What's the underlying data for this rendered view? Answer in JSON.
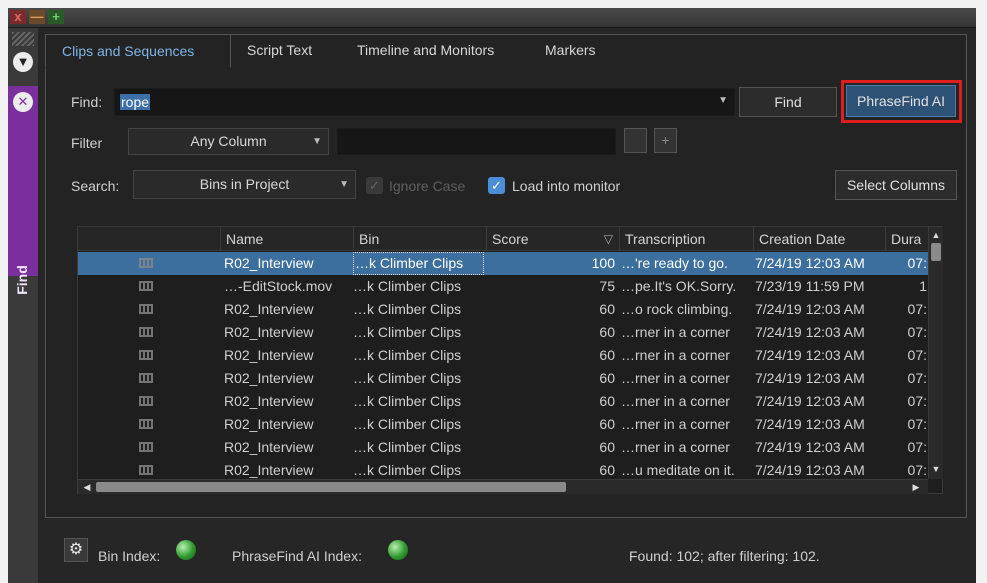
{
  "window": {
    "close_glyph": "x",
    "minimize_glyph": "—",
    "maximize_glyph": "+"
  },
  "sidebar": {
    "label": "Find",
    "top_icon": "caret-down-circle-icon",
    "close_icon": "close-circle-icon"
  },
  "tabs": [
    {
      "label": "Clips and Sequences",
      "active": true
    },
    {
      "label": "Script Text",
      "active": false
    },
    {
      "label": "Timeline and Monitors",
      "active": false
    },
    {
      "label": "Markers",
      "active": false
    }
  ],
  "find": {
    "label": "Find:",
    "value": "rope",
    "find_button": "Find",
    "phrasefind_button": "PhraseFind AI"
  },
  "filter": {
    "label": "Filter",
    "column_selected": "Any Column",
    "value": "",
    "add_glyph": "+"
  },
  "search": {
    "label": "Search:",
    "scope_selected": "Bins in Project",
    "ignore_case_label": "Ignore Case",
    "ignore_case_checked": false,
    "load_monitor_label": "Load into monitor",
    "load_monitor_checked": true,
    "select_columns_button": "Select Columns"
  },
  "table": {
    "columns": [
      "",
      "Name",
      "Bin",
      "Score",
      "Transcription",
      "Creation Date",
      "Dura"
    ],
    "sort_indicator": "▽",
    "rows": [
      {
        "name": "R02_Interview",
        "bin": "…k Climber Clips",
        "score": "100",
        "transcription": "…'re ready to go.",
        "date": "7/24/19 12:03 AM",
        "dur": "07:",
        "selected": true
      },
      {
        "name": "…-EditStock.mov",
        "bin": "…k Climber Clips",
        "score": "75",
        "transcription": "…pe.It's OK.Sorry.",
        "date": "7/23/19 11:59 PM",
        "dur": "1",
        "selected": false
      },
      {
        "name": "R02_Interview",
        "bin": "…k Climber Clips",
        "score": "60",
        "transcription": "…o rock climbing.",
        "date": "7/24/19 12:03 AM",
        "dur": "07:",
        "selected": false
      },
      {
        "name": "R02_Interview",
        "bin": "…k Climber Clips",
        "score": "60",
        "transcription": "…rner in a corner",
        "date": "7/24/19 12:03 AM",
        "dur": "07:",
        "selected": false
      },
      {
        "name": "R02_Interview",
        "bin": "…k Climber Clips",
        "score": "60",
        "transcription": "…rner in a corner",
        "date": "7/24/19 12:03 AM",
        "dur": "07:",
        "selected": false
      },
      {
        "name": "R02_Interview",
        "bin": "…k Climber Clips",
        "score": "60",
        "transcription": "…rner in a corner",
        "date": "7/24/19 12:03 AM",
        "dur": "07:",
        "selected": false
      },
      {
        "name": "R02_Interview",
        "bin": "…k Climber Clips",
        "score": "60",
        "transcription": "…rner in a corner",
        "date": "7/24/19 12:03 AM",
        "dur": "07:",
        "selected": false
      },
      {
        "name": "R02_Interview",
        "bin": "…k Climber Clips",
        "score": "60",
        "transcription": "…rner in a corner",
        "date": "7/24/19 12:03 AM",
        "dur": "07:",
        "selected": false
      },
      {
        "name": "R02_Interview",
        "bin": "…k Climber Clips",
        "score": "60",
        "transcription": "…rner in a corner",
        "date": "7/24/19 12:03 AM",
        "dur": "07:",
        "selected": false
      },
      {
        "name": "R02_Interview",
        "bin": "…k Climber Clips",
        "score": "60",
        "transcription": "…u meditate on it.",
        "date": "7/24/19 12:03 AM",
        "dur": "07:",
        "selected": false
      }
    ]
  },
  "status": {
    "bin_index_label": "Bin Index:",
    "phrasefind_index_label": "PhraseFind AI Index:",
    "found_text": "Found: 102; after filtering: 102."
  },
  "colors": {
    "accent_tab": "#7fb6e8",
    "selection": "#3d6f9e",
    "highlight_box": "#e01e1e",
    "sidebar_purple": "#7b2e9e",
    "index_led": "#2e9a2e"
  }
}
